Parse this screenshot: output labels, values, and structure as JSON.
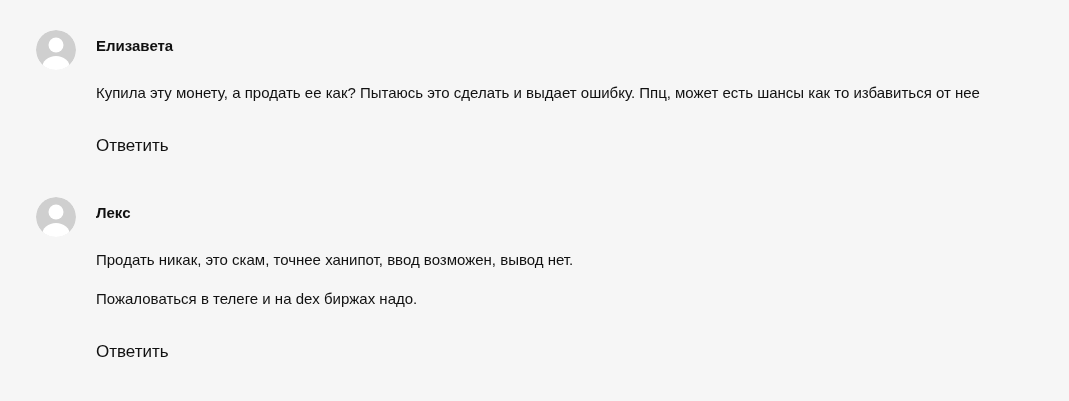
{
  "comments": [
    {
      "author": "Елизавета",
      "paragraphs": [
        "Купила эту монету, а продать ее как? Пытаюсь это сделать и выдает ошибку. Ппц, может есть шансы как то избавиться от нее"
      ],
      "reply": "Ответить"
    },
    {
      "author": "Лекс",
      "paragraphs": [
        "Продать никак, это скам, точнее ханипот, ввод возможен, вывод нет.",
        "Пожаловаться в телеге и на dex биржах надо."
      ],
      "reply": "Ответить"
    }
  ]
}
